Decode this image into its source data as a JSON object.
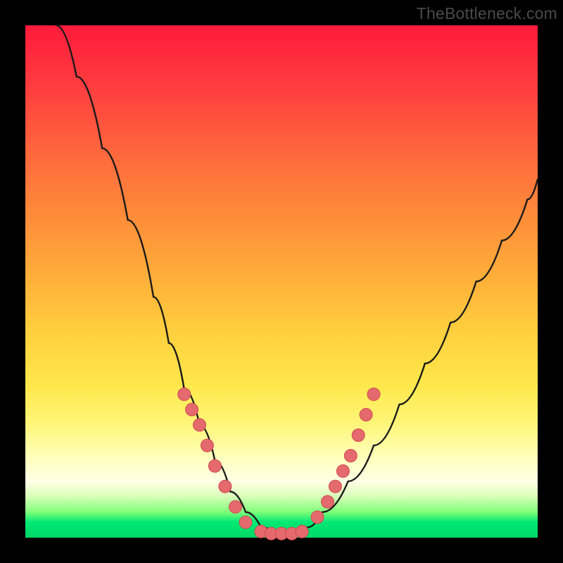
{
  "watermark": "TheBottleneck.com",
  "colors": {
    "bg_black": "#000000",
    "curve_stroke": "#1a1a1a",
    "marker_fill": "#e46a6d",
    "marker_stroke": "#d24a50",
    "gradient_top": "#ff1a3c",
    "gradient_bottom": "#00d867"
  },
  "chart_data": {
    "type": "line",
    "title": "",
    "xlabel": "",
    "ylabel": "",
    "xlim": [
      0,
      100
    ],
    "ylim": [
      0,
      100
    ],
    "grid": false,
    "legend": false,
    "note": "Plot area uses a vertical red→green gradient; values are approximate percentages read from the V-shaped curve in normalized 0–100 coordinate space (y = height from bottom).",
    "series": [
      {
        "name": "bottleneck-curve",
        "x": [
          6,
          10,
          15,
          20,
          25,
          28,
          31,
          34,
          37,
          40,
          43,
          46,
          49,
          52,
          55,
          58,
          63,
          68,
          73,
          78,
          83,
          88,
          93,
          98,
          100
        ],
        "y": [
          100,
          90,
          76,
          62,
          47,
          38,
          29,
          22,
          15,
          9,
          5,
          2,
          1,
          1,
          2,
          5,
          11,
          18,
          26,
          34,
          42,
          50,
          58,
          66,
          70
        ]
      },
      {
        "name": "left-markers",
        "x": [
          31,
          32.5,
          34,
          35.5,
          37,
          39,
          41,
          43
        ],
        "y": [
          28,
          25,
          22,
          18,
          14,
          10,
          6,
          3
        ]
      },
      {
        "name": "bottom-markers",
        "x": [
          46,
          48,
          50,
          52,
          54
        ],
        "y": [
          1.2,
          0.8,
          0.8,
          0.8,
          1.2
        ]
      },
      {
        "name": "right-markers",
        "x": [
          57,
          59,
          60.5,
          62,
          63.5,
          65,
          66.5,
          68
        ],
        "y": [
          4,
          7,
          10,
          13,
          16,
          20,
          24,
          28
        ]
      }
    ]
  }
}
